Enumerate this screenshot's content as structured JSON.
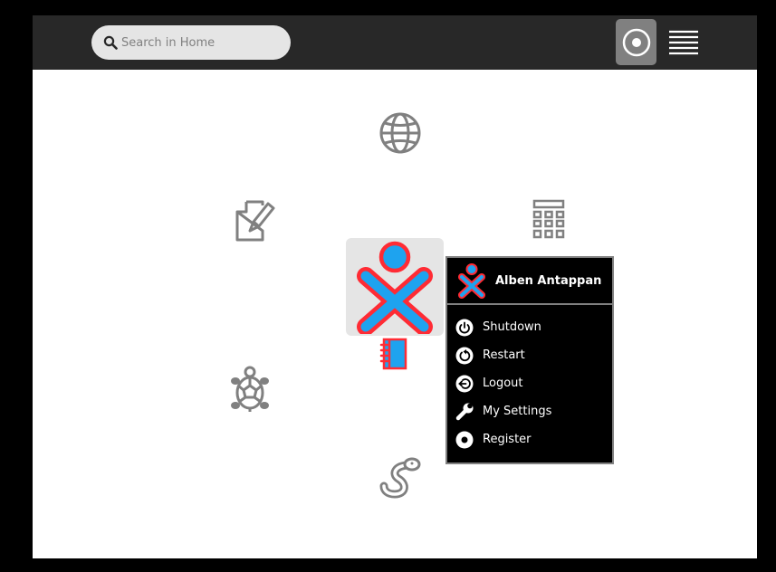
{
  "toolbar": {
    "search_placeholder": "Search in Home",
    "view_icon": "home-ring-icon",
    "list_icon": "list-view-icon"
  },
  "home": {
    "activities": [
      {
        "name": "browse-activity",
        "icon": "globe-icon"
      },
      {
        "name": "write-activity",
        "icon": "pen-paper-icon"
      },
      {
        "name": "calculate-activity",
        "icon": "calculator-icon"
      },
      {
        "name": "turtle-activity",
        "icon": "turtle-icon"
      },
      {
        "name": "pippy-activity",
        "icon": "snake-icon"
      },
      {
        "name": "journal",
        "icon": "journal-icon"
      }
    ],
    "owner_colors": {
      "stroke": "#ff2b34",
      "fill": "#1ea3ef"
    }
  },
  "palette": {
    "user_name": "Alben Antappan",
    "items": [
      {
        "label": "Shutdown",
        "icon": "power-icon"
      },
      {
        "label": "Restart",
        "icon": "restart-icon"
      },
      {
        "label": "Logout",
        "icon": "logout-icon"
      },
      {
        "label": "My Settings",
        "icon": "wrench-icon"
      },
      {
        "label": "Register",
        "icon": "register-icon"
      }
    ]
  }
}
